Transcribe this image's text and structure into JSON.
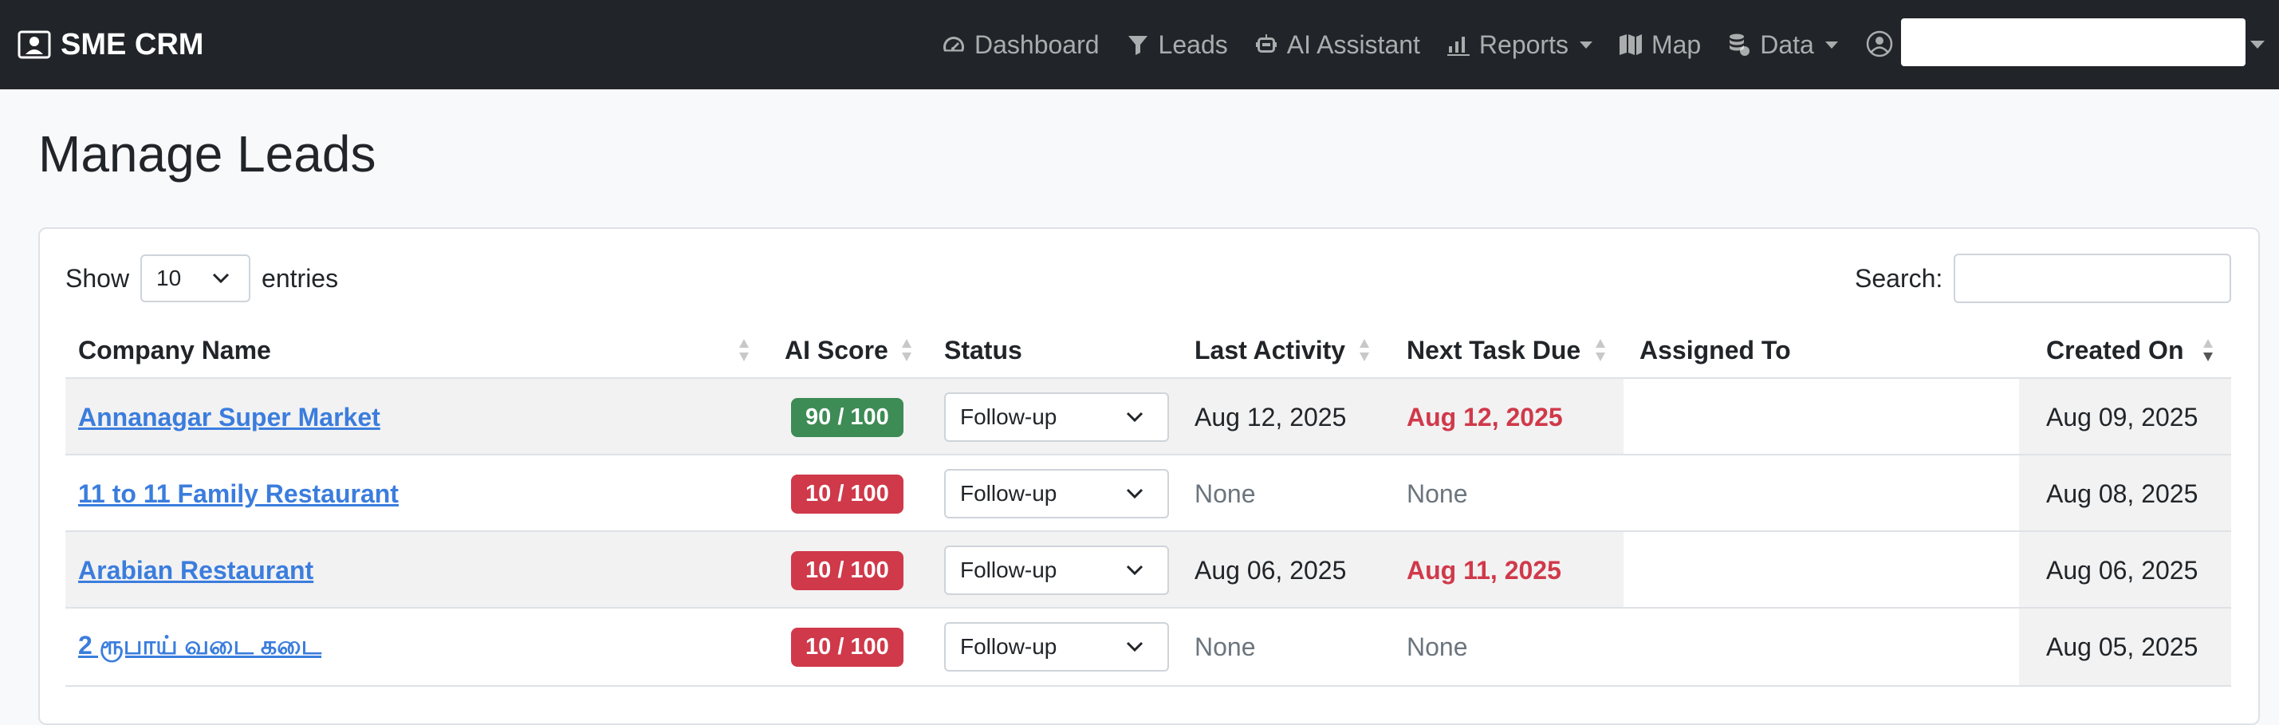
{
  "brand": {
    "name": "SME CRM",
    "icon": "contact-card-icon"
  },
  "nav": [
    {
      "label": "Dashboard",
      "icon": "gauge-icon",
      "dropdown": false
    },
    {
      "label": "Leads",
      "icon": "funnel-icon",
      "dropdown": false
    },
    {
      "label": "AI Assistant",
      "icon": "robot-icon",
      "dropdown": false
    },
    {
      "label": "Reports",
      "icon": "bar-chart-icon",
      "dropdown": true
    },
    {
      "label": "Map",
      "icon": "map-icon",
      "dropdown": false
    },
    {
      "label": "Data",
      "icon": "database-icon",
      "dropdown": true
    }
  ],
  "user": {
    "icon": "user-circle-icon",
    "name": ""
  },
  "page": {
    "title": "Manage Leads"
  },
  "table_controls": {
    "show_label": "Show",
    "entries_value": "10",
    "entries_label": "entries",
    "search_label": "Search:",
    "search_value": ""
  },
  "columns": {
    "company": "Company Name",
    "ai_score": "AI Score",
    "status": "Status",
    "last_activity": "Last Activity",
    "next_task": "Next Task Due",
    "assigned": "Assigned To",
    "created": "Created On"
  },
  "rows": [
    {
      "company": "Annanagar Super Market",
      "score": "90 / 100",
      "score_level": "high",
      "status": "Follow-up",
      "last_activity": "Aug 12, 2025",
      "next_task": "Aug 12, 2025",
      "next_task_overdue": true,
      "assigned": "",
      "created": "Aug 09, 2025"
    },
    {
      "company": "11 to 11 Family Restaurant",
      "score": "10 / 100",
      "score_level": "low",
      "status": "Follow-up",
      "last_activity": "None",
      "next_task": "None",
      "next_task_overdue": false,
      "assigned": "",
      "created": "Aug 08, 2025"
    },
    {
      "company": "Arabian Restaurant",
      "score": "10 / 100",
      "score_level": "low",
      "status": "Follow-up",
      "last_activity": "Aug 06, 2025",
      "next_task": "Aug 11, 2025",
      "next_task_overdue": true,
      "assigned": "",
      "created": "Aug 06, 2025"
    },
    {
      "company": "2 ரூபாய் வடை கடை",
      "score": "10 / 100",
      "score_level": "low",
      "status": "Follow-up",
      "last_activity": "None",
      "next_task": "None",
      "next_task_overdue": false,
      "assigned": "",
      "created": "Aug 05, 2025"
    }
  ],
  "colors": {
    "navbar": "#212529",
    "link": "#3b7ddd",
    "score_high": "#3d8b55",
    "score_low": "#d0394a",
    "overdue": "#d0394a"
  }
}
